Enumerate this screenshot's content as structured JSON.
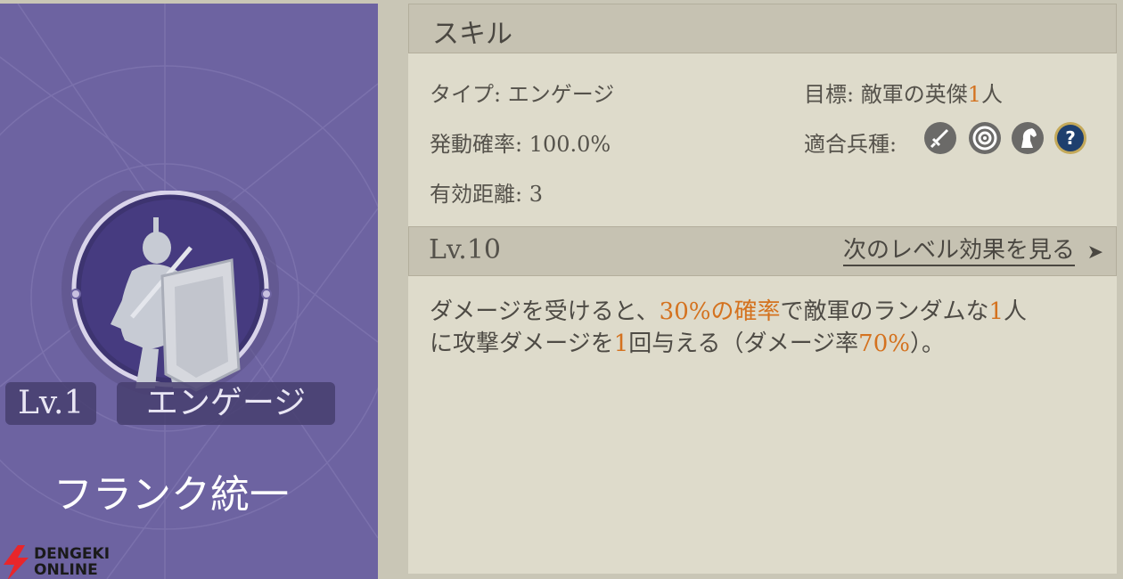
{
  "skill_card": {
    "level": "Lv.1",
    "skill_type_name": "エンゲージ",
    "title": "フランク統一"
  },
  "watermark": {
    "line1": "DENGEKI",
    "line2": "ONLINE"
  },
  "skill_panel": {
    "header": "スキル",
    "type": "タイプ: エンゲージ",
    "activation_rate": "発動確率: 100.0%",
    "effective_range": "有効距離: 3",
    "target_prefix": "目標: 敵軍の英傑",
    "target_count": "1",
    "target_suffix": "人",
    "unit_types_label": "適合兵種:",
    "unit_type_icons": [
      "sword-icon",
      "target-icon",
      "horse-icon",
      "question-icon"
    ]
  },
  "level_section": {
    "level": "Lv.10",
    "next_level_link": "次のレベル効果を見る",
    "description": {
      "p1": "ダメージを受けると、",
      "p2": "30%の確率",
      "p3": "で敵軍のランダムな",
      "p4": "1",
      "p5": "人",
      "p6": "に攻撃ダメージを",
      "p7": "1",
      "p8": "回与える（ダメージ率",
      "p9": "70%",
      "p10": "）。"
    }
  },
  "colors": {
    "highlight": "#d4721f",
    "card_purple": "#6d63a1",
    "panel_bg": "#dedbcb"
  }
}
